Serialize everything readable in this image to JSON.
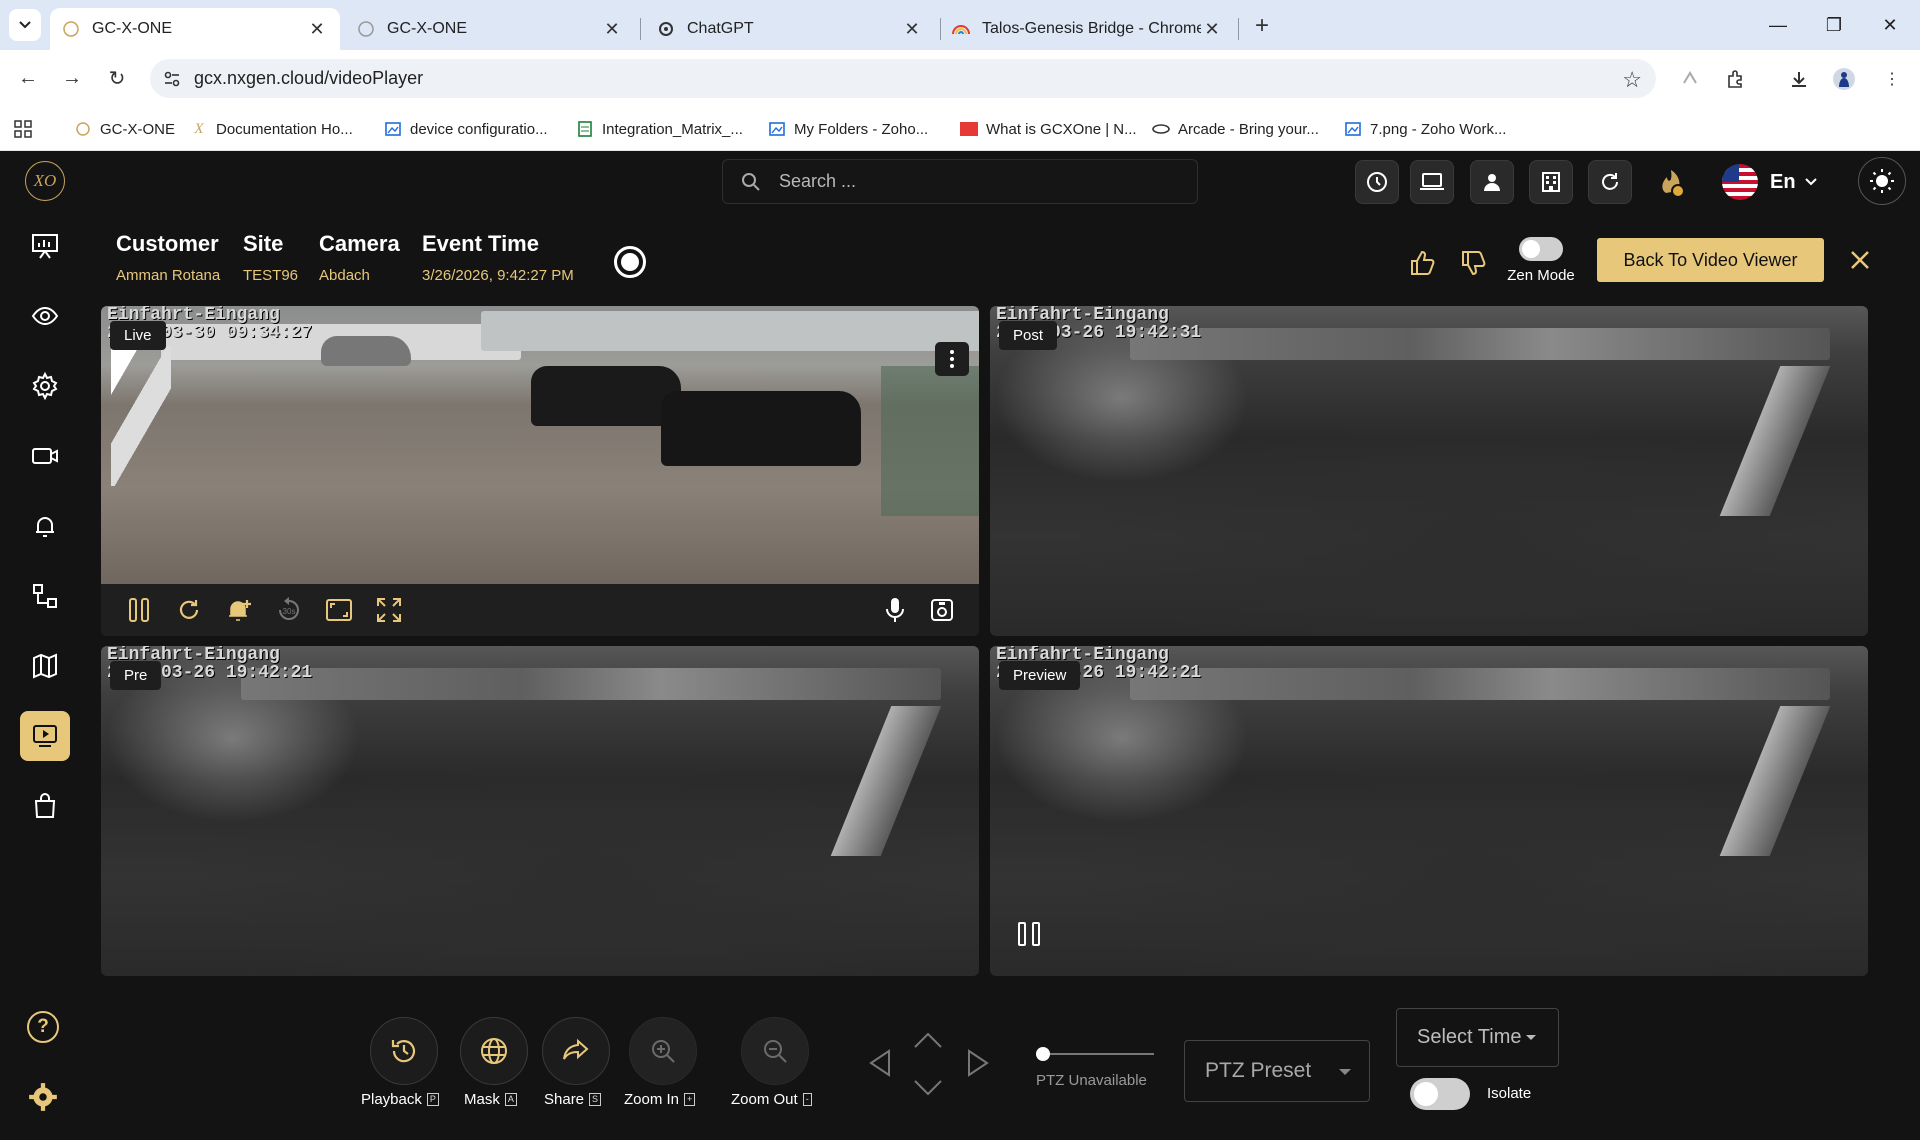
{
  "browser": {
    "tabs": [
      {
        "title": "GC-X-ONE",
        "active": true
      },
      {
        "title": "GC-X-ONE",
        "active": false
      },
      {
        "title": "ChatGPT",
        "active": false
      },
      {
        "title": "Talos-Genesis Bridge - Chrome",
        "active": false
      }
    ],
    "url": "gcx.nxgen.cloud/videoPlayer",
    "bookmarks": [
      "GC-X-ONE",
      "Documentation Ho...",
      "device configuratio...",
      "Integration_Matrix_...",
      "My Folders - Zoho...",
      "What is GCXOne | N...",
      "Arcade - Bring your...",
      "7.png - Zoho Work..."
    ]
  },
  "app": {
    "logo_text": "XO",
    "search_placeholder": "Search ...",
    "language": "En",
    "event": {
      "customer_label": "Customer",
      "customer_value": "Amman Rotana",
      "site_label": "Site",
      "site_value": "TEST96",
      "camera_label": "Camera",
      "camera_value": "Abdach",
      "event_time_label": "Event Time",
      "event_time_value": "3/26/2026, 9:42:27 PM"
    },
    "zen_mode_label": "Zen Mode",
    "back_button": "Back To Video Viewer",
    "videos": [
      {
        "tag": "Live",
        "overlay_name": "Einfahrt-Eingang",
        "timestamp": "2026-03-30 09:34:27"
      },
      {
        "tag": "Post",
        "overlay_name": "Einfahrt-Eingang",
        "timestamp": "2026-03-26 19:42:31"
      },
      {
        "tag": "Pre",
        "overlay_name": "Einfahrt-Eingang",
        "timestamp": "2026-03-26 19:42:21"
      },
      {
        "tag": "Preview",
        "overlay_name": "Einfahrt-Eingang",
        "timestamp": "2026-03-26 19:42:21"
      }
    ],
    "controls": {
      "playback": {
        "label": "Playback",
        "key": "P"
      },
      "mask": {
        "label": "Mask",
        "key": "A"
      },
      "share": {
        "label": "Share",
        "key": "S"
      },
      "zoom_in": {
        "label": "Zoom In",
        "key": "+"
      },
      "zoom_out": {
        "label": "Zoom Out",
        "key": "-"
      },
      "ptz_status": "PTZ Unavailable",
      "ptz_preset": "PTZ Preset",
      "select_time": "Select Time",
      "isolate": "Isolate"
    }
  },
  "colors": {
    "accent": "#e7c77a",
    "background": "#131313",
    "tabbar": "#dde7f5"
  }
}
